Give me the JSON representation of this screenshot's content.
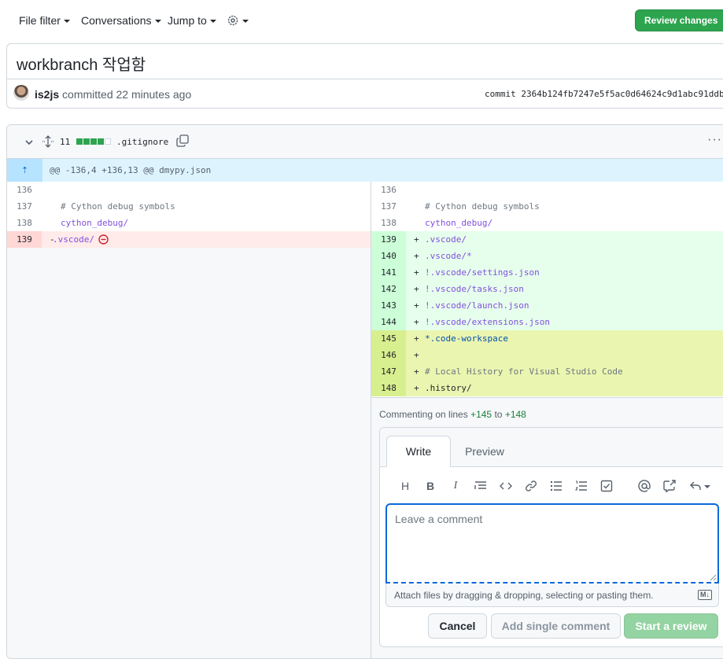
{
  "topnav": {
    "file_filter": "File filter",
    "conversations": "Conversations",
    "jump_to": "Jump to",
    "review_changes": "Review changes"
  },
  "commit": {
    "title": "workbranch 작업함",
    "author": "is2js",
    "action": "committed 22 minutes ago",
    "sha": "commit 2364b124fb7247e5f5ac0d64624c9d1abc91ddb"
  },
  "file": {
    "changes": "11",
    "name": ".gitignore",
    "hunk": "@@ -136,4 +136,13 @@ dmypy.json"
  },
  "left_lines": [
    {
      "n": "136",
      "sign": "",
      "text": ""
    },
    {
      "n": "137",
      "sign": "",
      "text": "# Cython debug symbols"
    },
    {
      "n": "138",
      "sign": "",
      "text": "cython_debug/"
    },
    {
      "n": "139",
      "sign": "-",
      "text": ".vscode/"
    }
  ],
  "right_lines": [
    {
      "n": "136",
      "sign": "",
      "text": ""
    },
    {
      "n": "137",
      "sign": "",
      "text": "# Cython debug symbols"
    },
    {
      "n": "138",
      "sign": "",
      "text": "cython_debug/"
    },
    {
      "n": "139",
      "sign": "+",
      "text": ".vscode/"
    },
    {
      "n": "140",
      "sign": "+",
      "text": ".vscode/*"
    },
    {
      "n": "141",
      "sign": "+",
      "text": "!.vscode/settings.json"
    },
    {
      "n": "142",
      "sign": "+",
      "text": "!.vscode/tasks.json"
    },
    {
      "n": "143",
      "sign": "+",
      "text": "!.vscode/launch.json"
    },
    {
      "n": "144",
      "sign": "+",
      "text": "!.vscode/extensions.json"
    },
    {
      "n": "145",
      "sign": "+",
      "text": "*.code-workspace"
    },
    {
      "n": "146",
      "sign": "+",
      "text": ""
    },
    {
      "n": "147",
      "sign": "+",
      "text": "# Local History for Visual Studio Code"
    },
    {
      "n": "148",
      "sign": "+",
      "text": ".history/"
    }
  ],
  "comment": {
    "commenting_prefix": "Commenting on lines",
    "from": "+145",
    "to_word": "to",
    "to": "+148",
    "tab_write": "Write",
    "tab_preview": "Preview",
    "placeholder": "Leave a comment",
    "attach": "Attach files by dragging & dropping, selecting or pasting them.",
    "md": "M↓",
    "cancel": "Cancel",
    "add_single": "Add single comment",
    "start_review": "Start a review"
  },
  "colors": {
    "accent": "#0969da",
    "green": "#2da44e",
    "added_bg": "#e6ffec",
    "deleted_bg": "#ffebe9",
    "selected_bg": "#eaf5b0"
  }
}
